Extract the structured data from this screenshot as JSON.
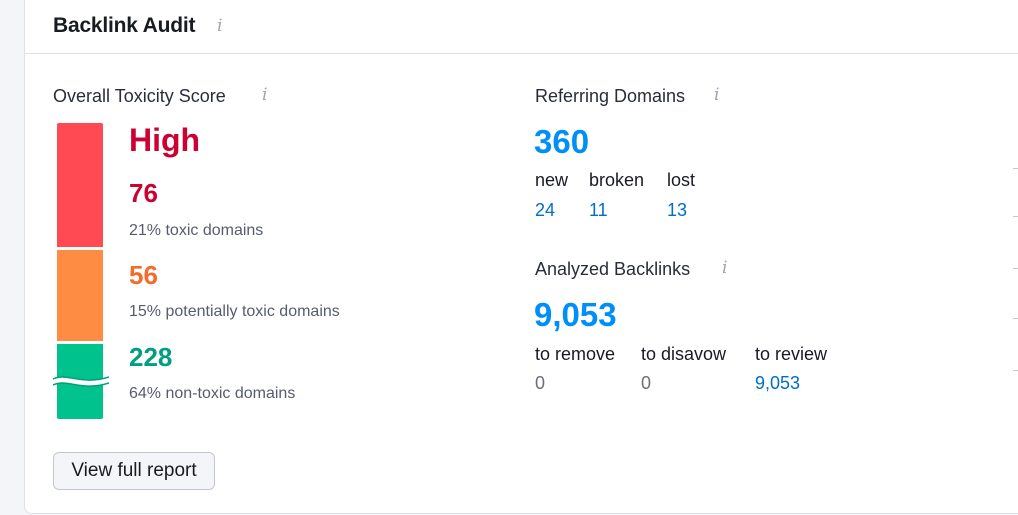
{
  "widget": {
    "title": "Backlink Audit",
    "view_report_label": "View full report"
  },
  "toxicity": {
    "label": "Overall Toxicity Score",
    "level": "High",
    "level_color": "#cc0033",
    "toxic": {
      "count": "76",
      "description": "21% toxic domains",
      "color": "#cc0033",
      "bar_color": "#ff4953"
    },
    "potentially_toxic": {
      "count": "56",
      "description": "15% potentially toxic domains",
      "color": "#f36b2d",
      "bar_color": "#ff8c43"
    },
    "non_toxic": {
      "count": "228",
      "description": "64% non-toxic domains",
      "color": "#009f81",
      "bar_color": "#00c28c"
    }
  },
  "referring_domains": {
    "label": "Referring Domains",
    "total": "360",
    "new_label": "new",
    "new_value": "24",
    "broken_label": "broken",
    "broken_value": "11",
    "lost_label": "lost",
    "lost_value": "13"
  },
  "analyzed_backlinks": {
    "label": "Analyzed Backlinks",
    "total": "9,053",
    "to_remove_label": "to remove",
    "to_remove_value": "0",
    "to_disavow_label": "to disavow",
    "to_disavow_value": "0",
    "to_review_label": "to review",
    "to_review_value": "9,053"
  },
  "icons": {
    "info": "i"
  },
  "colors": {
    "accent_blue": "#008ff8",
    "link_blue": "#006dca"
  }
}
